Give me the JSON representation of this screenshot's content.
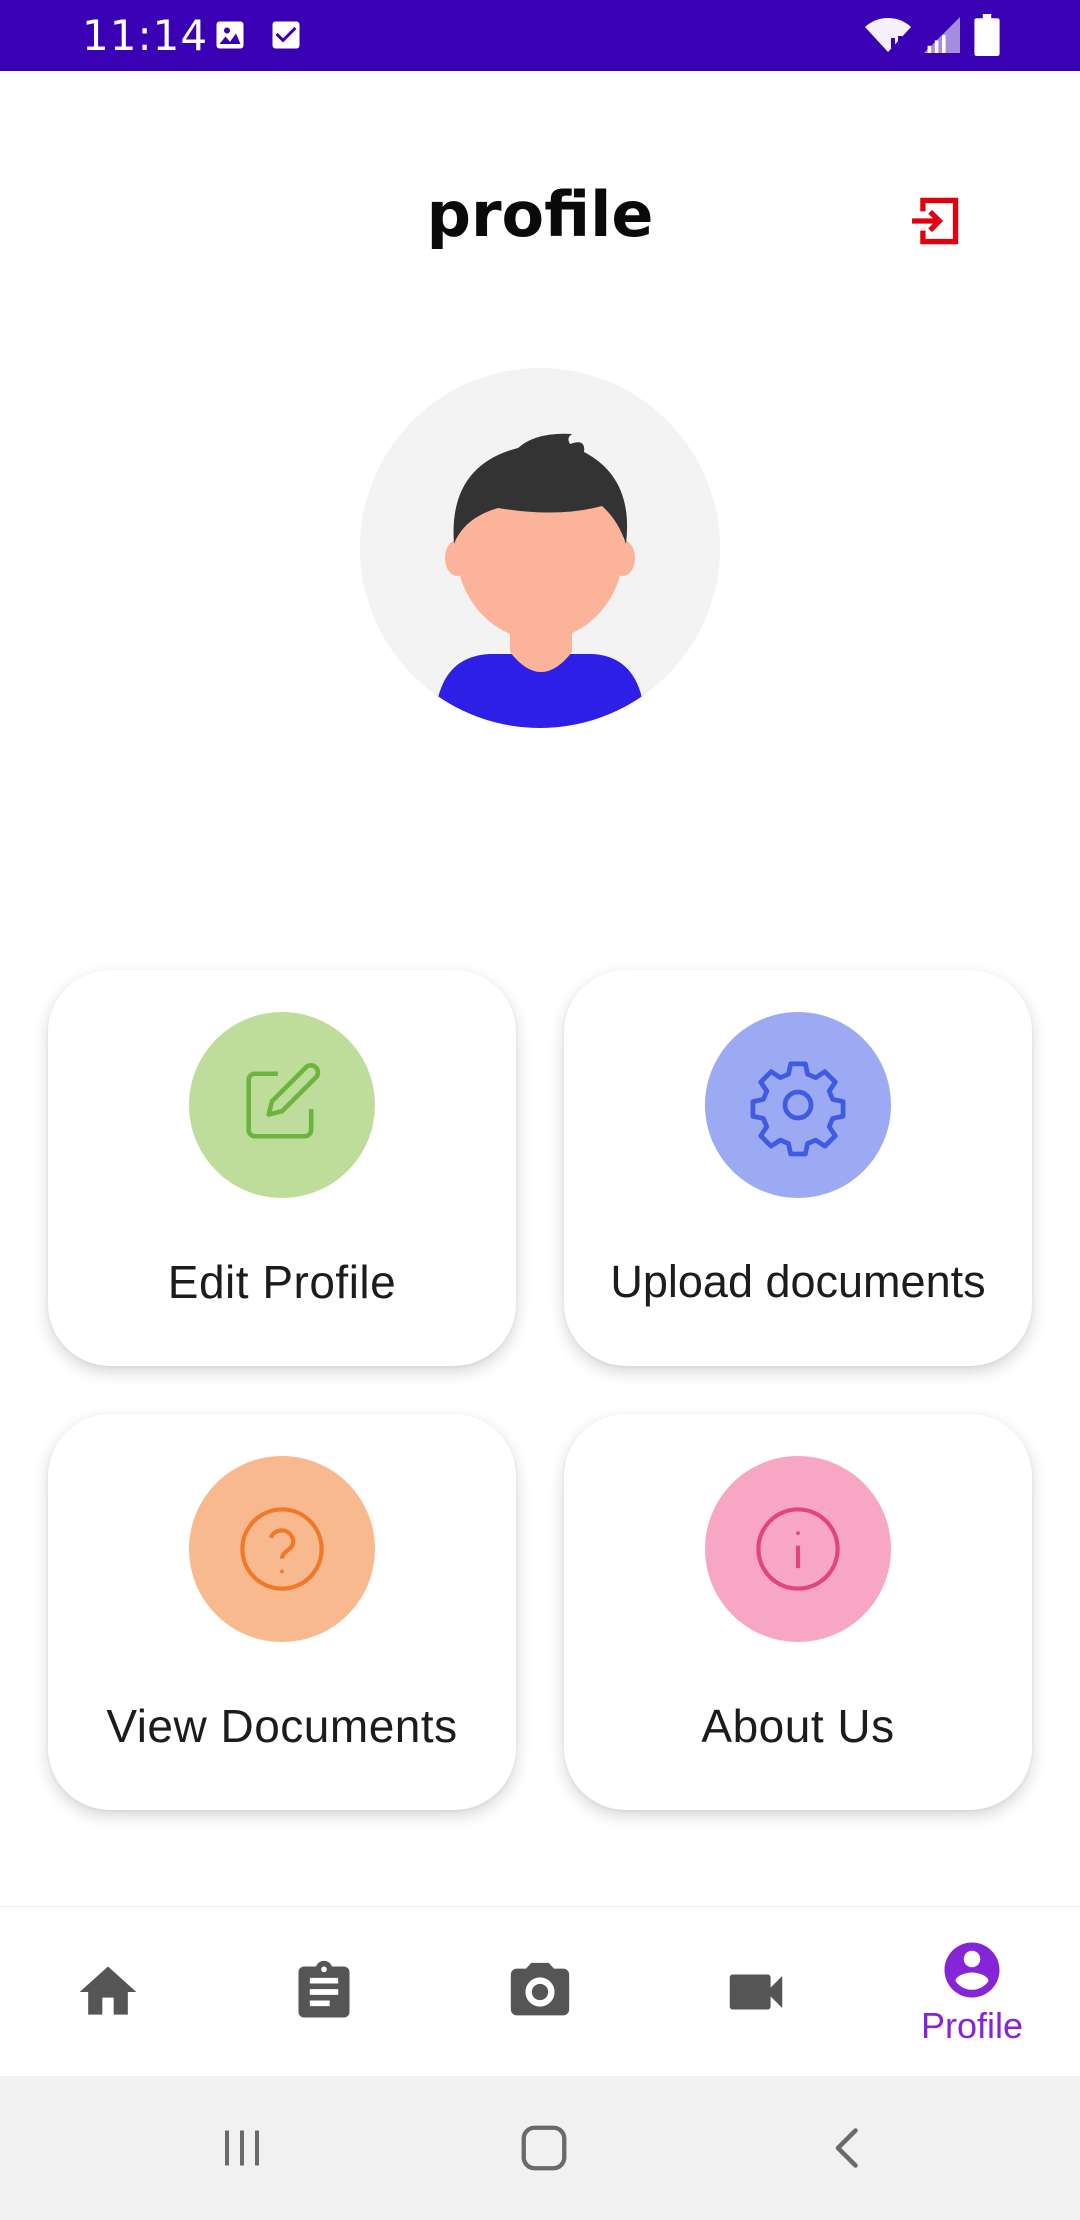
{
  "status_bar": {
    "time": "11:14",
    "background_color": "#3A00B3",
    "left_icons": [
      "image-icon",
      "checkbox-icon"
    ],
    "right_icons": [
      "wifi-icon",
      "signal-icon",
      "battery-icon"
    ]
  },
  "header": {
    "title": "profile",
    "logout_icon": "logout-icon",
    "logout_color": "#E0000F"
  },
  "avatar": {
    "icon": "user-avatar-illustration"
  },
  "cards": [
    {
      "label": "Edit Profile",
      "icon": "edit-icon",
      "circle_color": "#BEDD9A",
      "icon_color": "#6DB33F"
    },
    {
      "label": "Upload documents",
      "icon": "gear-icon",
      "circle_color": "#9BAAF2",
      "icon_color": "#3F5BE0"
    },
    {
      "label": "View Documents",
      "icon": "help-icon",
      "circle_color": "#F8B98E",
      "icon_color": "#F07828"
    },
    {
      "label": "About Us",
      "icon": "info-icon",
      "circle_color": "#F7A7C3",
      "icon_color": "#E5437C"
    }
  ],
  "bottom_nav": {
    "items": [
      {
        "icon": "home-icon",
        "label": ""
      },
      {
        "icon": "clipboard-icon",
        "label": ""
      },
      {
        "icon": "camera-icon",
        "label": ""
      },
      {
        "icon": "video-icon",
        "label": ""
      },
      {
        "icon": "profile-icon",
        "label": "Profile",
        "active": true
      }
    ],
    "active_color": "#8624D8",
    "inactive_color": "#555555"
  },
  "system_nav": {
    "items": [
      "recent-apps-icon",
      "home-button-icon",
      "back-icon"
    ]
  }
}
